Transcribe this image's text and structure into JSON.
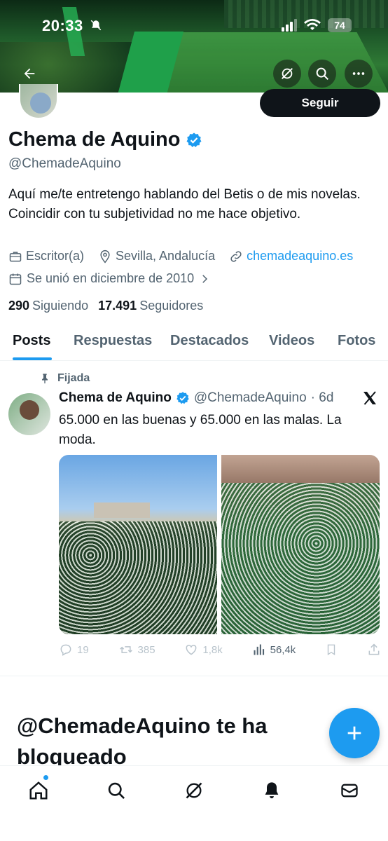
{
  "status_bar": {
    "time": "20:33",
    "battery": "74"
  },
  "profile": {
    "display_name": "Chema de Aquino",
    "handle": "@ChemadeAquino",
    "follow_button": "Seguir",
    "bio": "Aquí me/te entretengo hablando del Betis o de mis novelas. Coincidir con tu subjetividad no me hace objetivo.",
    "occupation": "Escritor(a)",
    "location": "Sevilla, Andalucía",
    "website": "chemadeaquino.es",
    "joined": "Se unió en diciembre de 2010",
    "following_count": "290",
    "following_label": "Siguiendo",
    "followers_count": "17.491",
    "followers_label": "Seguidores"
  },
  "tabs": [
    {
      "label": "Posts"
    },
    {
      "label": "Respuestas"
    },
    {
      "label": "Destacados"
    },
    {
      "label": "Videos"
    },
    {
      "label": "Fotos"
    }
  ],
  "pinned_post": {
    "pinned_label": "Fijada",
    "author_name": "Chema de Aquino",
    "author_handle": "@ChemadeAquino",
    "time": "· 6d",
    "text": "65.000 en las buenas y 65.000 en las malas. La moda.",
    "replies": "19",
    "reposts": "385",
    "likes": "1,8k",
    "views": "56,4k"
  },
  "blocked_message": "@ChemadeAquino te ha bloqueado",
  "colors": {
    "accent": "#1d9bf0",
    "text": "#0f1419",
    "secondary": "#536471"
  }
}
